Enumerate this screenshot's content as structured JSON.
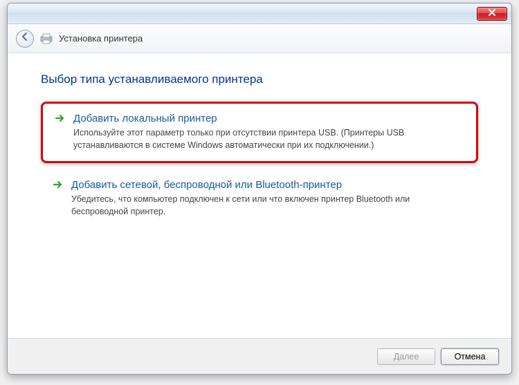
{
  "titlebar": {
    "close_label": "Close"
  },
  "header": {
    "title": "Установка принтера"
  },
  "page": {
    "heading": "Выбор типа устанавливаемого принтера"
  },
  "options": [
    {
      "title": "Добавить локальный принтер",
      "desc": "Используйте этот параметр только при отсутствии принтера USB. (Принтеры USB устанавливаются в системе Windows автоматически при их подключении.)",
      "highlighted": true
    },
    {
      "title": "Добавить сетевой, беспроводной или Bluetooth-принтер",
      "desc": "Убедитесь, что компьютер подключен к сети или что включен принтер Bluetooth или беспроводной принтер.",
      "highlighted": false
    }
  ],
  "footer": {
    "next_label": "Далее",
    "cancel_label": "Отмена"
  }
}
